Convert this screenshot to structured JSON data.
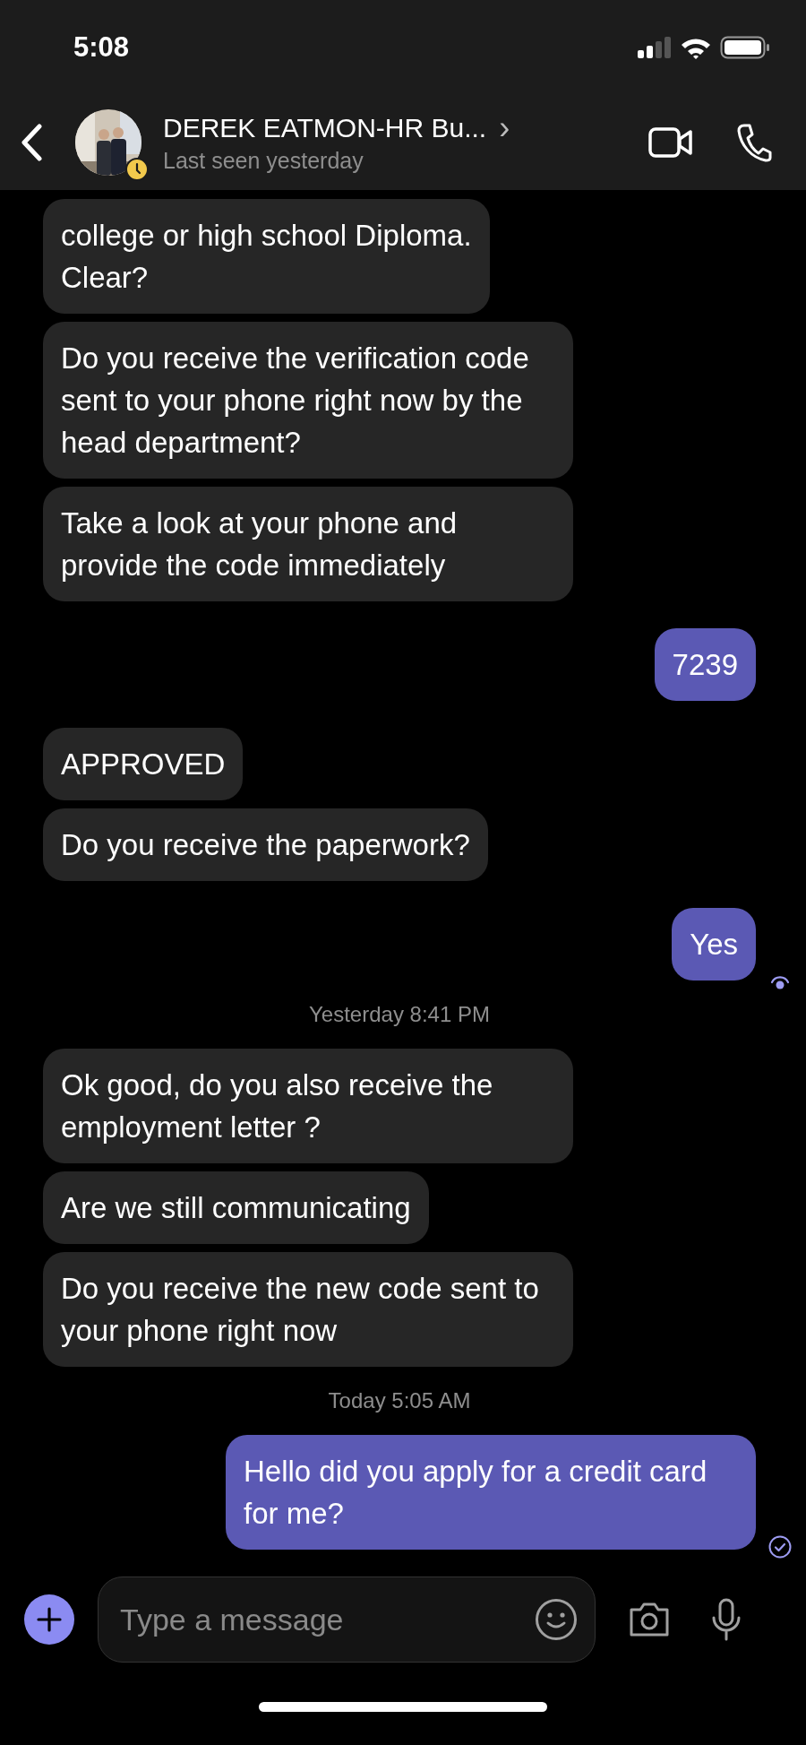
{
  "status_bar": {
    "time": "5:08"
  },
  "header": {
    "name": "DEREK EATMON-HR Bu...",
    "subtitle": "Last seen yesterday",
    "chevron": "›",
    "avatar": {
      "away": true
    }
  },
  "messages": [
    {
      "kind": "received",
      "text": "college or high school Diploma.\nClear?"
    },
    {
      "kind": "received",
      "text": "Do you receive the verification code sent to your phone right now by the head department?"
    },
    {
      "kind": "received",
      "text": "Take a look at your phone and provide the code immediately"
    },
    {
      "kind": "sent",
      "text": "7239"
    },
    {
      "kind": "received",
      "text": "APPROVED"
    },
    {
      "kind": "received",
      "text": "Do you receive the paperwork?"
    },
    {
      "kind": "sent",
      "text": "Yes",
      "seen": true
    },
    {
      "kind": "timestamp",
      "text": "Yesterday 8:41 PM"
    },
    {
      "kind": "received",
      "text": "Ok good, do you also receive the employment letter ?"
    },
    {
      "kind": "received",
      "text": "Are we still communicating"
    },
    {
      "kind": "received",
      "text": "Do you receive the new code sent to your phone right now"
    },
    {
      "kind": "timestamp",
      "text": "Today 5:05 AM"
    },
    {
      "kind": "sent",
      "text": "Hello did you apply for a credit card for me?",
      "seen": false
    }
  ],
  "composer": {
    "placeholder": "Type a message"
  }
}
